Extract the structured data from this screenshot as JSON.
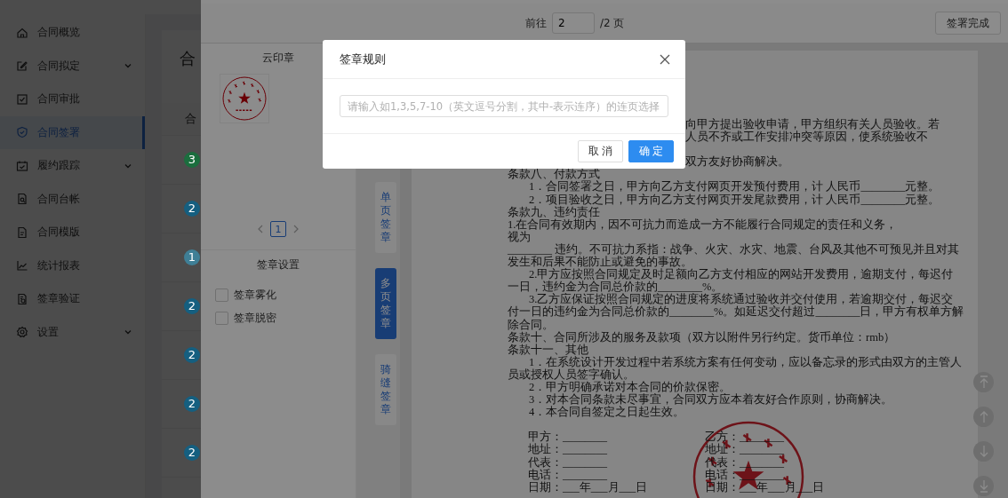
{
  "sidebar": {
    "items": [
      {
        "label": "合同概览",
        "expandable": false,
        "selected": false
      },
      {
        "label": "合同拟定",
        "expandable": true,
        "selected": false
      },
      {
        "label": "合同审批",
        "expandable": false,
        "selected": false
      },
      {
        "label": "合同签署",
        "expandable": false,
        "selected": true
      },
      {
        "label": "履约跟踪",
        "expandable": true,
        "selected": false
      },
      {
        "label": "合同台帐",
        "expandable": false,
        "selected": false
      },
      {
        "label": "合同模版",
        "expandable": false,
        "selected": false
      },
      {
        "label": "统计报表",
        "expandable": false,
        "selected": false
      },
      {
        "label": "签章验证",
        "expandable": false,
        "selected": false
      },
      {
        "label": "设置",
        "expandable": true,
        "selected": false
      }
    ]
  },
  "main": {
    "title": "合",
    "table_header": "合",
    "rows": [
      {
        "badge": "3",
        "color": "#1b6e3e"
      },
      {
        "badge": "2",
        "color": "#155f80"
      },
      {
        "badge": "1",
        "color": "#3f7f96"
      },
      {
        "badge": "2",
        "color": "#155f80"
      },
      {
        "badge": "2",
        "color": "#155f80"
      },
      {
        "badge": "2",
        "color": "#155f80"
      },
      {
        "badge": "2",
        "color": "#155f80"
      }
    ]
  },
  "drawer": {
    "toolbar": {
      "goto_label": "前往",
      "page_value": "2",
      "page_total": "/2 页",
      "finish_button": "签署完成"
    },
    "seal_panel": {
      "title": "云印章",
      "pages": [
        {
          "label": "1",
          "selected": true
        }
      ]
    },
    "settings": {
      "title": "签章设置",
      "options": [
        {
          "label": "签章雾化",
          "checked": false
        },
        {
          "label": "签章脱密",
          "checked": false
        }
      ]
    },
    "sign_modes": [
      {
        "label": "单页签章",
        "selected": false
      },
      {
        "label": "多页签章",
        "selected": true
      },
      {
        "label": "骑缝签章",
        "selected": false
      }
    ],
    "document": {
      "lines": [
        {
          "kind": "tail",
          "text": "向甲方提出验收申请，甲方组织有关人员验收。若"
        },
        {
          "kind": "tail",
          "text": "人员不齐或工作安排冲突等原因，使系统验收不"
        },
        {
          "kind": "gap"
        },
        {
          "kind": "tail",
          "text": "双方友好协商解决。"
        },
        {
          "kind": "line",
          "text": "条款八、付款方式"
        },
        {
          "kind": "indent",
          "text": "1．合同签署之日，甲方向乙方支付网页开发预付费用，计 人民币________元整。"
        },
        {
          "kind": "indent",
          "text": "2．项目验收之日，甲方向乙方支付网页开发尾款费用，计 人民币________元整。"
        },
        {
          "kind": "line",
          "text": "条款九、违约责任"
        },
        {
          "kind": "line",
          "text": "1.在合同有效期内，因不可抗力而造成一方不能履行合同规定的责任和义务，"
        },
        {
          "kind": "line",
          "text": "视为"
        },
        {
          "kind": "line",
          "text": "________ 违约。不可抗力系指：战争、火灾、水灾、地震、台风及其他不可预见并且对其"
        },
        {
          "kind": "line",
          "text": "发生和后果不能防止或避免的事故。"
        },
        {
          "kind": "indent",
          "text": "2.甲方应按照合同规定及时足额向乙方支付相应的网站开发费用，逾期支付，每迟付"
        },
        {
          "kind": "line",
          "text": "一日，违约金为合同总价款的________%。"
        },
        {
          "kind": "indent",
          "text": "3.乙方应保证按照合同规定的进度将系统通过验收并交付使用，若逾期交付，每迟交"
        },
        {
          "kind": "line",
          "text": "付一日的违约金为合同总价款的________%。如延迟交付超过________日，甲方有权单方解"
        },
        {
          "kind": "line",
          "text": "除合同。"
        },
        {
          "kind": "line",
          "text": "条款十、合同所涉及的服务及款项（双方以附件另行约定。货币单位：rmb）"
        },
        {
          "kind": "line",
          "text": "条款十一、其他"
        },
        {
          "kind": "indent",
          "text": "1．在系统设计开发过程中若系统方案有任何变动，应以备忘录的形式由双方的主管人"
        },
        {
          "kind": "line",
          "text": "员或授权人员签字确认。"
        },
        {
          "kind": "indent",
          "text": "2．甲方明确承诺对本合同的价款保密。"
        },
        {
          "kind": "indent",
          "text": "3．对本合同条款未尽事宜，合同双方应本着友好合作原则，协商解决。"
        },
        {
          "kind": "indent",
          "text": "4．本合同自签定之日起生效。"
        },
        {
          "kind": "gap"
        }
      ],
      "signature": [
        {
          "left": "甲方：________",
          "right": "乙方：________"
        },
        {
          "left": "地址：________",
          "right": "地址：________"
        },
        {
          "left": "代表：________",
          "right": "代表：________"
        },
        {
          "left": "电话：________",
          "right": "电话：________"
        },
        {
          "left": "日期：___年___月___日",
          "right": "日期：___年___月___日"
        }
      ]
    }
  },
  "modal": {
    "title": "签章规则",
    "input": {
      "placeholder": "请输入如1,3,5,7-10（英文逗号分割，其中-表示连序）的连页选择"
    },
    "buttons": [
      {
        "label": "取消",
        "kind": "default"
      },
      {
        "label": "确定",
        "kind": "primary"
      }
    ]
  }
}
